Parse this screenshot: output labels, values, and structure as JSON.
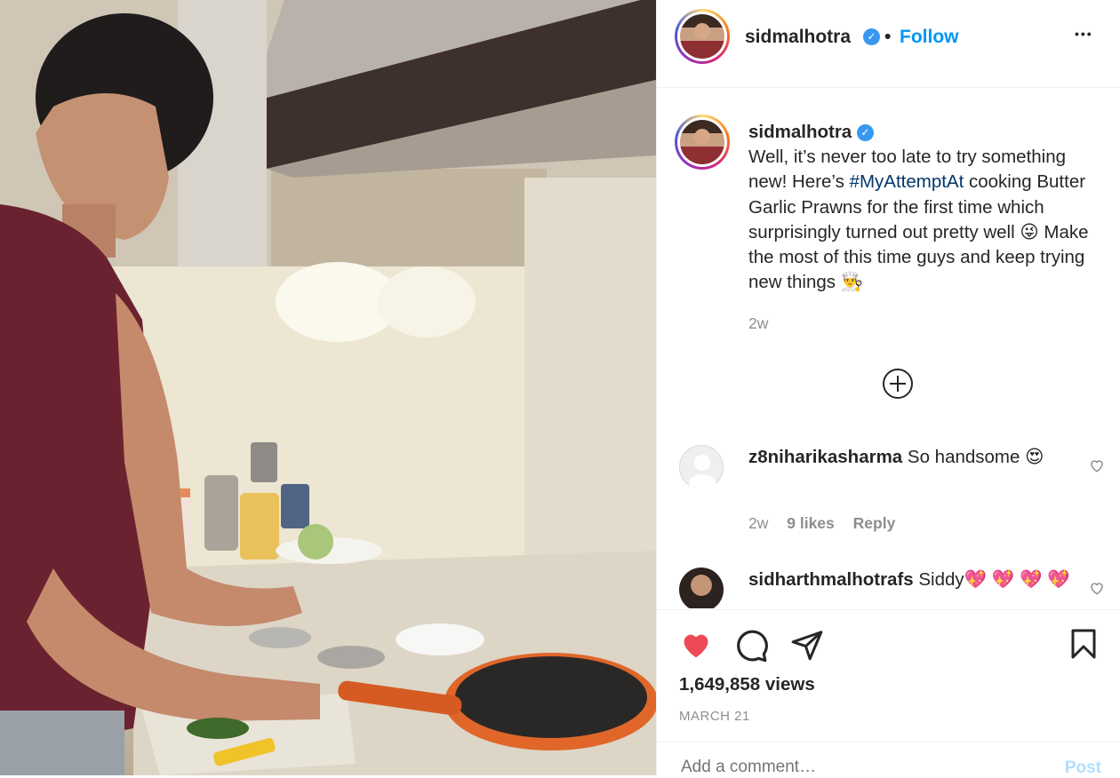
{
  "post": {
    "username": "sidmalhotra",
    "follow_label": "Follow",
    "separator": "•",
    "more_label": "•••"
  },
  "caption": {
    "username": "sidmalhotra",
    "text_before": "Well, it’s never too late to try something new! Here’s ",
    "hashtag": "#MyAttemptAt",
    "text_after": " cooking Butter Garlic Prawns for the first time which surprisingly turned out pretty well 😜  Make the most of this time guys and keep trying new things 👨‍🍳",
    "time": "2w"
  },
  "comments": [
    {
      "username": "z8niharikasharma",
      "text": "So handsome 😍",
      "time": "2w",
      "likes": "9 likes",
      "reply_label": "Reply"
    },
    {
      "username": "sidharthmalhotrafs",
      "text": "Siddy💖 💖 💖 💖"
    }
  ],
  "stats": {
    "views": "1,649,858 views",
    "date": "MARCH 21"
  },
  "add_comment": {
    "placeholder": "Add a comment…",
    "post_label": "Post"
  },
  "colors": {
    "accent": "#0095f6",
    "like": "#ed4956",
    "verified": "#3897f0"
  },
  "icons": [
    "verified-badge-icon",
    "more-options-icon",
    "add-comment-circle-icon",
    "heart-icon",
    "comment-icon",
    "share-icon",
    "bookmark-icon"
  ]
}
